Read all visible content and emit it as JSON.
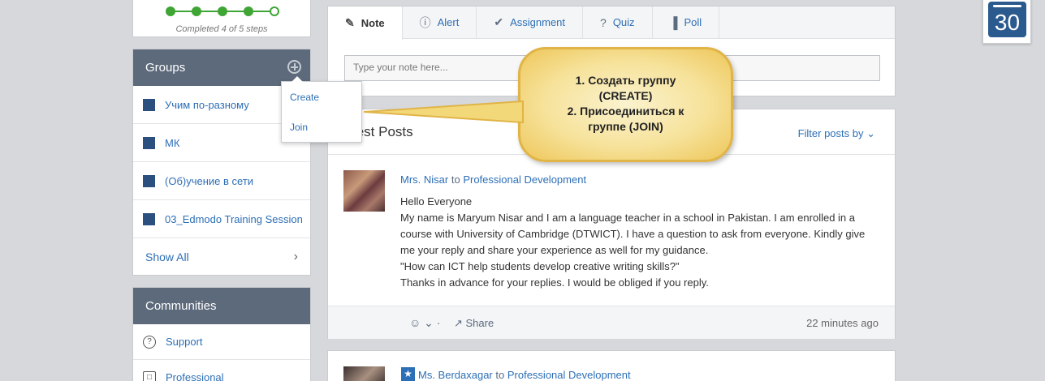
{
  "progress": {
    "label": "Completed 4 of 5 steps",
    "completed": 4,
    "total": 5,
    "color": "#3fa535"
  },
  "groups": {
    "title": "Groups",
    "items": [
      {
        "label": "Учим по-разному"
      },
      {
        "label": "МК"
      },
      {
        "label": "(Об)учение в сети"
      },
      {
        "label": "03_Edmodo Training Session"
      }
    ],
    "show_all": "Show All",
    "menu": {
      "create": "Create",
      "join": "Join"
    }
  },
  "communities": {
    "title": "Communities",
    "items": [
      {
        "label": "Support"
      },
      {
        "label": "Professional"
      }
    ]
  },
  "composer": {
    "tabs": [
      {
        "label": "Note",
        "icon": "note-icon"
      },
      {
        "label": "Alert",
        "icon": "alert-icon"
      },
      {
        "label": "Assignment",
        "icon": "assignment-icon"
      },
      {
        "label": "Quiz",
        "icon": "quiz-icon"
      },
      {
        "label": "Poll",
        "icon": "poll-icon"
      }
    ],
    "placeholder": "Type your note here..."
  },
  "callout": {
    "line1": "1. Создать группу",
    "line2": "(CREATE)",
    "line3": "2. Присоединиться к",
    "line4": "группе (JOIN)"
  },
  "feed": {
    "title": "test Posts",
    "filter": "Filter posts by",
    "post": {
      "author": "Mrs. Nisar",
      "to": "to",
      "group": "Professional Development",
      "lines": [
        "Hello Everyone",
        "My name is Maryum Nisar and I am a language teacher in a school in Pakistan. I am enrolled in a",
        "course with University of Cambridge (DTWICT). I have a question to ask from everyone. Kindly give",
        "me your reply and share your experience as well for my guidance.",
        "\"How can ICT help students develop creative writing skills?\"",
        "Thanks in advance for your replies. I would be obliged if you reply."
      ],
      "share": "Share",
      "time": "22 minutes ago"
    },
    "post2": {
      "author": "Ms. Berdaxagar",
      "to": "to",
      "group": "Professional Development"
    }
  },
  "calendar": {
    "day": "30"
  }
}
